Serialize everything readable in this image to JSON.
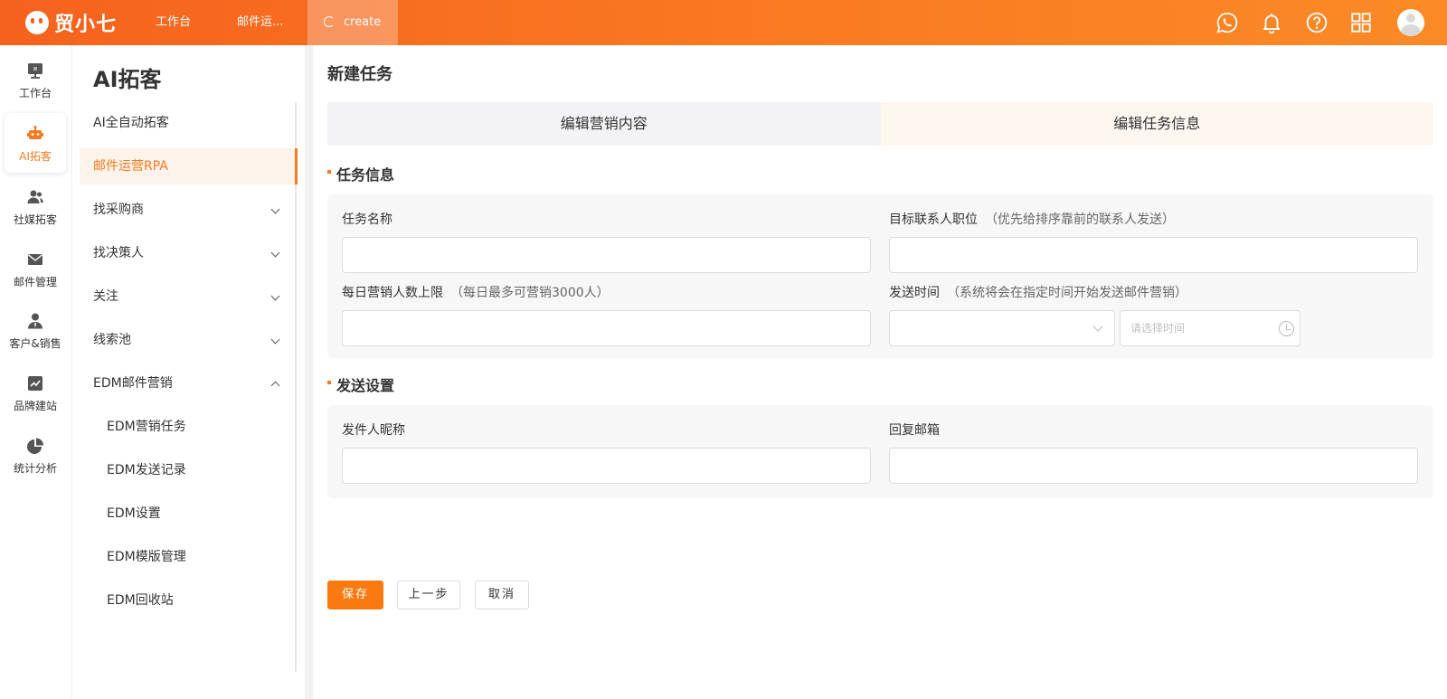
{
  "topbar": {
    "logo_text": "贸小七",
    "nav": [
      {
        "label": "工作台"
      },
      {
        "label": "邮件运..."
      },
      {
        "label": "create"
      }
    ],
    "icons": [
      "whatsapp-icon",
      "bell-icon",
      "help-icon",
      "apps-grid-icon",
      "user-avatar"
    ]
  },
  "rail": {
    "items": [
      {
        "label": "工作台",
        "icon": "monitor-icon"
      },
      {
        "label": "AI拓客",
        "icon": "robot-icon"
      },
      {
        "label": "社媒拓客",
        "icon": "users-icon"
      },
      {
        "label": "邮件管理",
        "icon": "mail-icon"
      },
      {
        "label": "客户&销售",
        "icon": "customer-icon"
      },
      {
        "label": "品牌建站",
        "icon": "chart-line-icon"
      },
      {
        "label": "统计分析",
        "icon": "pie-chart-icon"
      }
    ]
  },
  "menu": {
    "title": "AI拓客",
    "items": [
      {
        "label": "AI全自动拓客"
      },
      {
        "label": "邮件运营RPA"
      },
      {
        "label": "找采购商"
      },
      {
        "label": "找决策人"
      },
      {
        "label": "关注"
      },
      {
        "label": "线索池"
      },
      {
        "label": "EDM邮件营销"
      },
      {
        "label": "EDM营销任务"
      },
      {
        "label": "EDM发送记录"
      },
      {
        "label": "EDM设置"
      },
      {
        "label": "EDM模版管理"
      },
      {
        "label": "EDM回收站"
      }
    ]
  },
  "main": {
    "title": "新建任务",
    "steps": [
      {
        "label": "编辑营销内容"
      },
      {
        "label": "编辑任务信息"
      }
    ],
    "task_section": {
      "heading": "任务信息",
      "task_name_label": "任务名称",
      "target_position_label": "目标联系人职位",
      "target_position_hint": "（优先给排序靠前的联系人发送）",
      "daily_limit_label": "每日营销人数上限",
      "daily_limit_hint": "（每日最多可营销3000人）",
      "send_time_label": "发送时间",
      "send_time_hint": "（系统将会在指定时间开始发送邮件营销）",
      "time_placeholder": "请选择时间"
    },
    "send_section": {
      "heading": "发送设置",
      "sender_label": "发件人昵称",
      "reply_label": "回复邮箱"
    },
    "buttons": {
      "save": "保存",
      "prev": "上一步",
      "cancel": "取消"
    }
  },
  "colors": {
    "accent": "#fa7a22",
    "topbar_start": "#f5621e",
    "topbar_end": "#fb8a26"
  }
}
